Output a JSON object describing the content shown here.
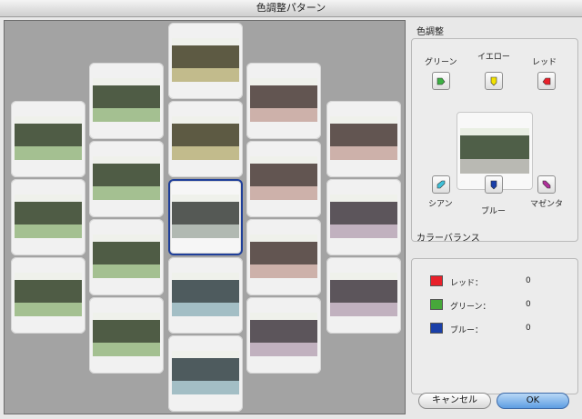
{
  "window": {
    "title": "色調整パターン"
  },
  "variations": [
    {
      "id": "t01",
      "tint": "green"
    },
    {
      "id": "t02",
      "tint": "green"
    },
    {
      "id": "t03",
      "tint": "green"
    },
    {
      "id": "t04",
      "tint": "green"
    },
    {
      "id": "t05",
      "tint": "green"
    },
    {
      "id": "t06",
      "tint": "green"
    },
    {
      "id": "t07",
      "tint": "green"
    },
    {
      "id": "t08",
      "tint": "yellow"
    },
    {
      "id": "t09",
      "tint": "yellow"
    },
    {
      "id": "t10",
      "tint": "neutral"
    },
    {
      "id": "t11",
      "tint": "cyan"
    },
    {
      "id": "t12",
      "tint": "cyan"
    },
    {
      "id": "t13",
      "tint": "red"
    },
    {
      "id": "t14",
      "tint": "red"
    },
    {
      "id": "t15",
      "tint": "red"
    },
    {
      "id": "t16",
      "tint": "magenta"
    },
    {
      "id": "t17",
      "tint": "red"
    },
    {
      "id": "t18",
      "tint": "magenta"
    },
    {
      "id": "t19",
      "tint": "magenta"
    }
  ],
  "tint_colors": {
    "green": "#8fa77e",
    "yellow": "#a9a37a",
    "neutral": "#9aa19b",
    "cyan": "#8ea5ab",
    "red": "#b29a94",
    "magenta": "#a89aa6"
  },
  "color_adjust": {
    "title": "色調整",
    "green_label": "グリーン",
    "yellow_label": "イエロー",
    "red_label": "レッド",
    "cyan_label": "シアン",
    "blue_label": "ブルー",
    "magenta_label": "マゼンタ",
    "chip_colors": {
      "green": "#3cb043",
      "yellow": "#f2e200",
      "red": "#e8202a",
      "cyan": "#3fc0d8",
      "blue": "#1a3fa8",
      "magenta": "#b0309a"
    }
  },
  "color_balance": {
    "title": "カラーバランス",
    "rows": [
      {
        "label": "レッド：",
        "value": "0",
        "color": "#e8202a"
      },
      {
        "label": "グリーン：",
        "value": "0",
        "color": "#47a83a"
      },
      {
        "label": "ブルー：",
        "value": "0",
        "color": "#1a3fa8"
      }
    ]
  },
  "buttons": {
    "cancel": "キャンセル",
    "ok": "OK"
  }
}
